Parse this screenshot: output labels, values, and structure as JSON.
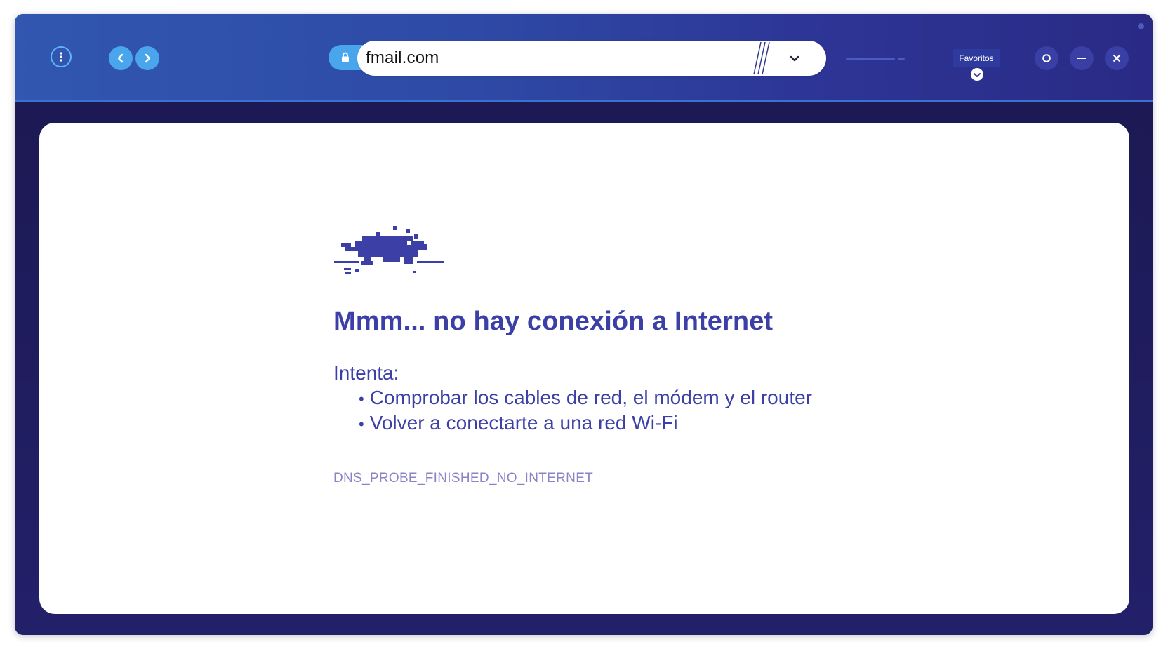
{
  "colors": {
    "toolbar_left": "#3157b0",
    "toolbar_right": "#2a2a85",
    "accent_blue": "#4aa6ec",
    "text_primary": "#3b3fa6",
    "text_code": "#8a84c6",
    "window_bg": "#1b1850",
    "page_bg": "#ffffff"
  },
  "toolbar": {
    "menu_icon": "kebab-menu-icon",
    "back_icon": "chevron-left-icon",
    "forward_icon": "chevron-right-icon",
    "lock_icon": "lock-icon",
    "url": "fmail.com",
    "dropdown_icon": "chevron-down-icon",
    "bookmarks_label": "Favoritos",
    "bookmarks_icon": "chevron-down-circle-icon",
    "window_controls": {
      "maximize_icon": "circle-icon",
      "minimize_icon": "minus-icon",
      "close_icon": "close-icon"
    }
  },
  "error_page": {
    "illustration": "pixel-dinosaur-icon",
    "title": "Mmm... no hay conexión a Internet",
    "try_label": "Intenta:",
    "suggestions": [
      "Comprobar los cables de red, el módem y el router",
      "Volver a conectarte a una red Wi-Fi"
    ],
    "error_code": "DNS_PROBE_FINISHED_NO_INTERNET"
  }
}
